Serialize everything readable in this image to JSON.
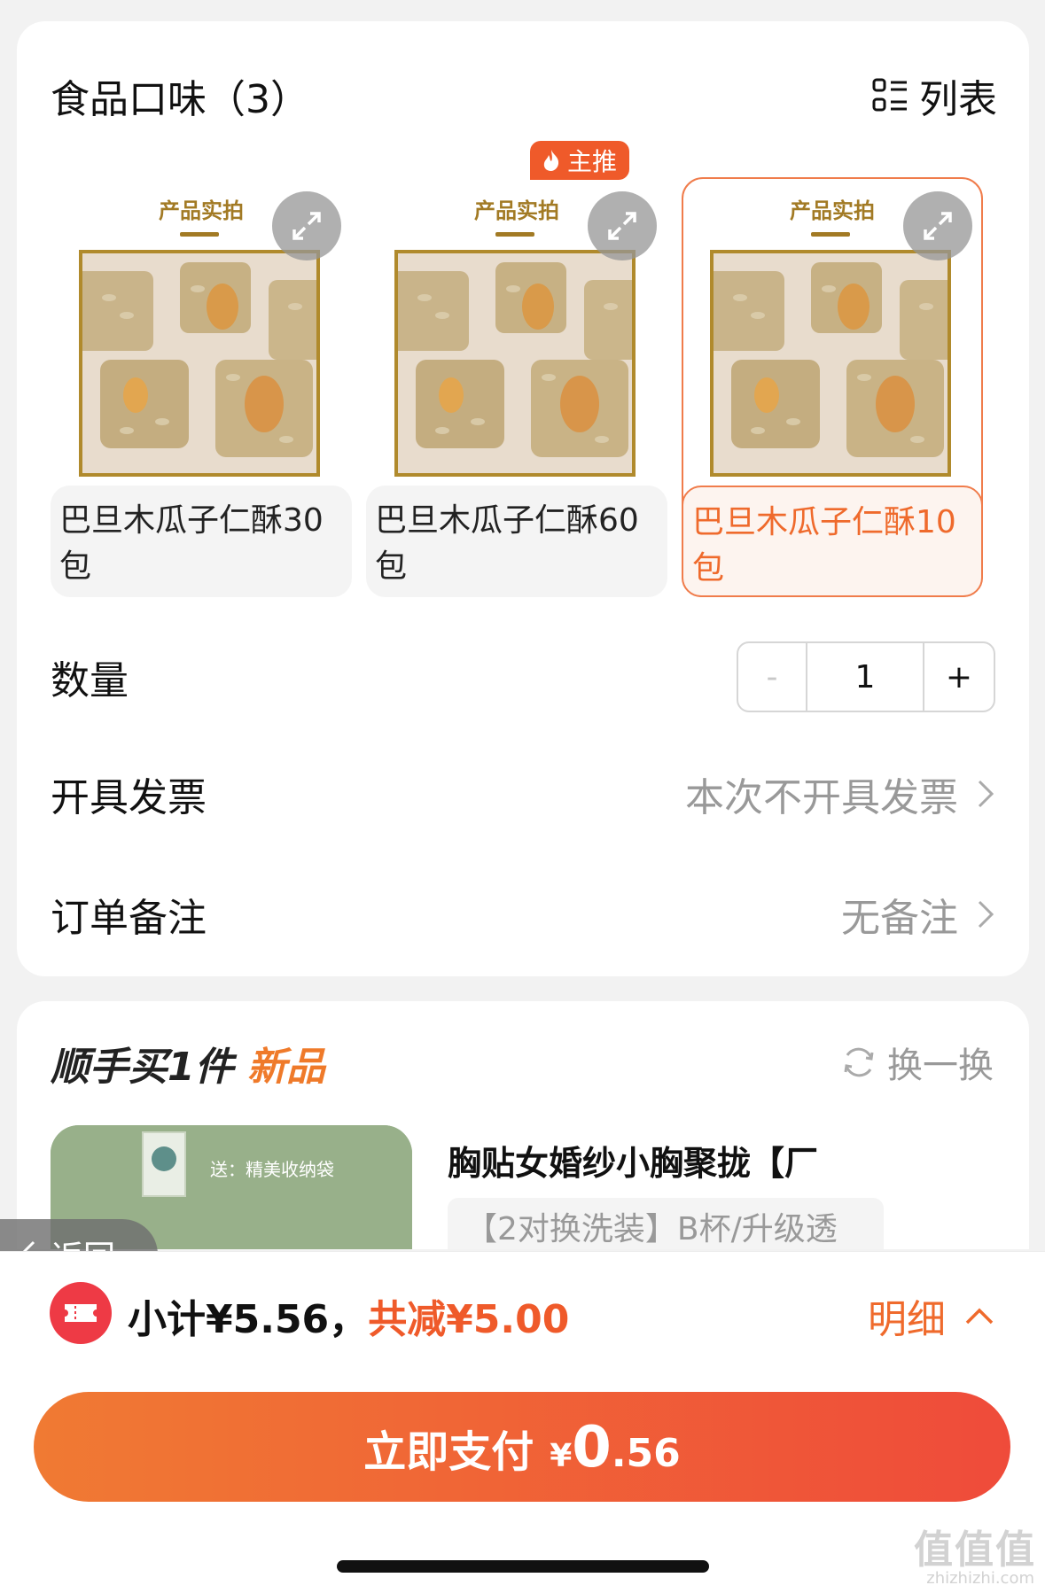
{
  "flavor_section": {
    "title": "食品口味（3）",
    "list_toggle_label": "列表",
    "badge_label": "主推",
    "photo_caption": "产品实拍",
    "options": [
      {
        "label": "巴旦木瓜子仁酥30包",
        "selected": false
      },
      {
        "label": "巴旦木瓜子仁酥60包",
        "selected": false,
        "badge": "主推"
      },
      {
        "label": "巴旦木瓜子仁酥10包",
        "selected": true
      }
    ]
  },
  "quantity": {
    "label": "数量",
    "minus": "-",
    "value": "1",
    "plus": "+"
  },
  "invoice": {
    "label": "开具发票",
    "value": "本次不开具发票"
  },
  "note": {
    "label": "订单备注",
    "value": "无备注"
  },
  "addon": {
    "title_prefix": "顺手买1件",
    "title_highlight": "新品",
    "swap_label": "换一换",
    "product_name": "胸贴女婚纱小胸聚拢【厂",
    "product_spec": "【2对换洗装】B杯/升级透",
    "image_banner": "送：精美收纳袋"
  },
  "back_label": "返回",
  "summary": {
    "subtotal": "小计¥5.56，",
    "saved": "共减¥5.00",
    "detail_label": "明细"
  },
  "pay_button": {
    "label": "立即支付",
    "currency": "¥",
    "int": "0",
    "dec": ".56"
  },
  "watermark": {
    "brand": "值值值",
    "url": "zhizhizhi.com"
  },
  "colors": {
    "accent": "#ef6a2c",
    "pay_start": "#f07a33",
    "pay_end": "#ef4b3a",
    "coupon": "#ee3a45"
  }
}
